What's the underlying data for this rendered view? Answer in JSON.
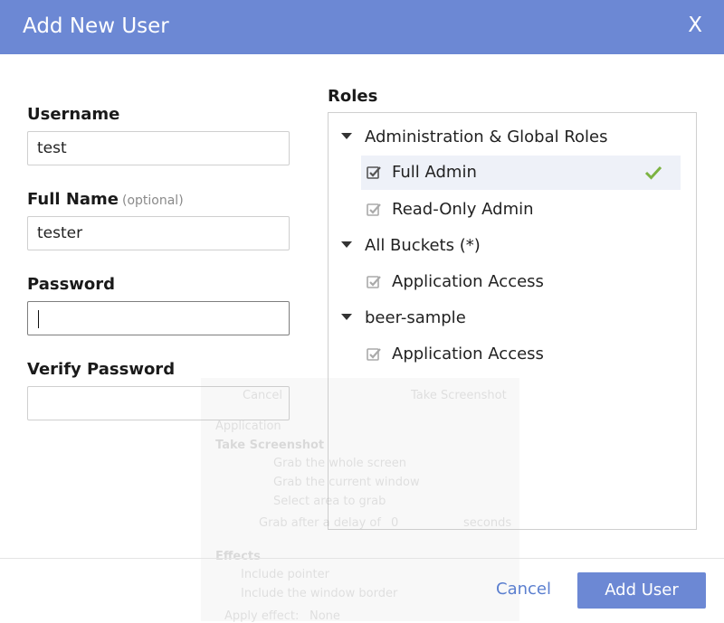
{
  "dialog": {
    "title": "Add New User",
    "close_label": "X"
  },
  "form": {
    "username": {
      "label": "Username",
      "value": "test"
    },
    "full_name": {
      "label": "Full Name",
      "optional_label": "(optional)",
      "value": "tester"
    },
    "password": {
      "label": "Password",
      "value": ""
    },
    "verify_password": {
      "label": "Verify Password",
      "value": ""
    }
  },
  "roles": {
    "label": "Roles",
    "groups": [
      {
        "name": "Administration & Global Roles",
        "items": [
          {
            "label": "Full Admin",
            "checked": true,
            "selected": true
          },
          {
            "label": "Read-Only Admin",
            "checked": true,
            "selected": false
          }
        ]
      },
      {
        "name": "All Buckets (*)",
        "items": [
          {
            "label": "Application Access",
            "checked": true,
            "selected": false
          }
        ]
      },
      {
        "name": "beer-sample",
        "items": [
          {
            "label": "Application Access",
            "checked": true,
            "selected": false
          }
        ]
      }
    ]
  },
  "footer": {
    "cancel_label": "Cancel",
    "submit_label": "Add User"
  },
  "ghost_overlay": {
    "cancel": "Cancel",
    "take_screenshot_btn": "Take Screenshot",
    "app_name": "Application",
    "section_title": "Take Screenshot",
    "option_1": "Grab the whole screen",
    "option_2": "Grab the current window",
    "option_3": "Select area to grab",
    "delay_label": "Grab after a delay of",
    "delay_value": "0",
    "delay_unit": "seconds",
    "effects_title": "Effects",
    "effect_1": "Include pointer",
    "effect_2": "Include the window border",
    "apply_effect": "Apply effect:",
    "apply_value": "None"
  },
  "colors": {
    "header": "#6c88d4",
    "accent": "#5b7fcf",
    "check_green": "#7cb342"
  }
}
